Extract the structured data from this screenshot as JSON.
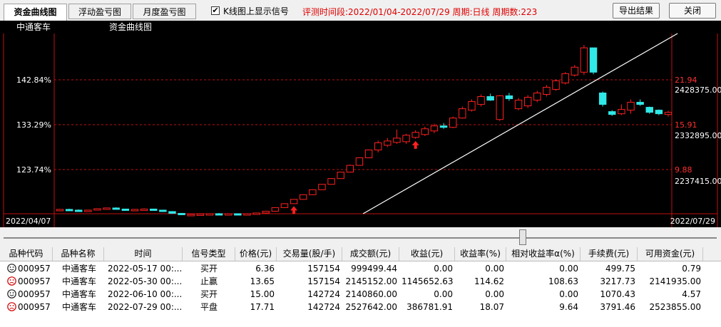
{
  "tabs": [
    {
      "label": "资金曲线图",
      "active": true
    },
    {
      "label": "浮动盈亏图",
      "active": false
    },
    {
      "label": "月度盈亏图",
      "active": false
    }
  ],
  "show_signal": {
    "checked": true,
    "mark": "✔",
    "label": "K线图上显示信号"
  },
  "info_text": "评测时间段:2022/01/04-2022/07/29  周期:日线  周期数:223",
  "buttons": {
    "export": "导出结果",
    "close": "关闭"
  },
  "chart": {
    "stock_name": "中通客车",
    "chart_title": "资金曲线图",
    "left_axis": [
      "142.84%",
      "133.29%",
      "123.74%"
    ],
    "right_axis_prices": [
      "21.94",
      "15.91",
      "9.88"
    ],
    "right_axis_volumes": [
      "2428375.00",
      "2332895.00",
      "2237415.00"
    ],
    "start_date": "2022/04/07",
    "end_date": "2022/07/29",
    "colors": {
      "up": "#ff2020",
      "down": "#30e8e8",
      "line": "#ffffff",
      "grid": "#c01010"
    }
  },
  "chart_data": {
    "type": "candlestick",
    "x_start": "2022/04/07",
    "x_end": "2022/07/29",
    "candles": [
      [
        5.6,
        5.7,
        5.5,
        5.65
      ],
      [
        5.65,
        5.75,
        5.55,
        5.6
      ],
      [
        5.55,
        5.65,
        5.45,
        5.5
      ],
      [
        5.5,
        5.6,
        5.4,
        5.55
      ],
      [
        5.6,
        5.8,
        5.55,
        5.75
      ],
      [
        5.75,
        5.9,
        5.7,
        5.85
      ],
      [
        5.85,
        5.95,
        5.65,
        5.7
      ],
      [
        5.7,
        5.75,
        5.55,
        5.6
      ],
      [
        5.6,
        5.7,
        5.5,
        5.65
      ],
      [
        5.65,
        5.8,
        5.6,
        5.7
      ],
      [
        5.7,
        5.75,
        5.5,
        5.55
      ],
      [
        5.55,
        5.6,
        5.3,
        5.35
      ],
      [
        5.35,
        5.4,
        5.05,
        5.1
      ],
      [
        5.1,
        5.15,
        4.85,
        4.9
      ],
      [
        4.9,
        5.0,
        4.8,
        4.95
      ],
      [
        4.95,
        5.05,
        4.85,
        5.0
      ],
      [
        5.0,
        5.1,
        4.95,
        5.05
      ],
      [
        5.05,
        5.15,
        4.95,
        5.0
      ],
      [
        5.0,
        5.1,
        4.95,
        5.05
      ],
      [
        5.05,
        5.1,
        4.95,
        5.0
      ],
      [
        5.0,
        5.1,
        4.95,
        5.05
      ],
      [
        5.05,
        5.2,
        5.0,
        5.15
      ],
      [
        5.15,
        5.45,
        5.1,
        5.4
      ],
      [
        5.4,
        5.95,
        5.35,
        5.9
      ],
      [
        5.9,
        6.5,
        5.85,
        6.45
      ],
      [
        6.45,
        7.1,
        6.4,
        7.05
      ],
      [
        7.05,
        7.75,
        7.0,
        7.7
      ],
      [
        7.7,
        8.45,
        7.65,
        8.4
      ],
      [
        8.4,
        9.2,
        8.35,
        9.15
      ],
      [
        9.15,
        10.0,
        9.1,
        9.95
      ],
      [
        9.95,
        10.9,
        9.9,
        10.85
      ],
      [
        10.85,
        11.9,
        10.8,
        11.8
      ],
      [
        11.8,
        12.9,
        11.75,
        12.85
      ],
      [
        12.85,
        14.0,
        12.8,
        13.95
      ],
      [
        13.95,
        15.25,
        13.6,
        14.95
      ],
      [
        14.6,
        15.6,
        14.35,
        15.2
      ],
      [
        15.0,
        16.8,
        14.8,
        15.6
      ],
      [
        15.1,
        16.2,
        14.8,
        16.0
      ],
      [
        15.7,
        16.7,
        15.5,
        16.4
      ],
      [
        16.1,
        17.2,
        15.9,
        16.9
      ],
      [
        16.6,
        17.6,
        16.3,
        17.3
      ],
      [
        17.3,
        17.7,
        16.9,
        17.1
      ],
      [
        17.1,
        18.6,
        17.0,
        18.4
      ],
      [
        18.4,
        20.0,
        18.3,
        19.7
      ],
      [
        19.5,
        21.0,
        19.3,
        20.7
      ],
      [
        20.3,
        21.7,
        20.0,
        21.4
      ],
      [
        21.4,
        21.8,
        20.8,
        20.9
      ],
      [
        18.2,
        21.6,
        18.0,
        21.5
      ],
      [
        21.5,
        21.9,
        20.8,
        21.1
      ],
      [
        19.7,
        21.2,
        19.5,
        20.9
      ],
      [
        20.1,
        21.6,
        19.8,
        21.3
      ],
      [
        20.9,
        22.2,
        20.6,
        21.9
      ],
      [
        21.7,
        23.0,
        21.4,
        22.7
      ],
      [
        22.4,
        23.8,
        22.2,
        23.6
      ],
      [
        23.3,
        24.8,
        23.1,
        24.6
      ],
      [
        24.4,
        25.8,
        24.2,
        25.5
      ],
      [
        24.8,
        28.6,
        24.4,
        28.2
      ],
      [
        28.2,
        27.0,
        24.5,
        24.8
      ],
      [
        21.9,
        22.1,
        20.0,
        20.3
      ],
      [
        19.3,
        19.5,
        18.7,
        18.9
      ],
      [
        19.0,
        20.3,
        18.8,
        19.6
      ],
      [
        19.5,
        21.0,
        19.0,
        20.6
      ],
      [
        20.6,
        21.0,
        20.1,
        20.3
      ],
      [
        19.9,
        20.0,
        19.0,
        19.2
      ],
      [
        19.5,
        19.6,
        18.8,
        19.0
      ],
      [
        18.9,
        19.4,
        18.6,
        19.2
      ]
    ],
    "signals": [
      {
        "type": "buy",
        "index": 25
      },
      {
        "type": "buy",
        "index": 38
      }
    ],
    "equity_line": {
      "from_index": 33,
      "to_index": 66
    }
  },
  "table": {
    "columns": [
      "品种代码",
      "品种名称",
      "时间",
      "信号类型",
      "价格(元)",
      "交易量(股/手)",
      "成交额(元)",
      "收益(元)",
      "收益率(%)",
      "相对收益率α(%)",
      "手续费(元)",
      "可用资金(元)"
    ],
    "rows": [
      {
        "result": "neutral",
        "code": "000957",
        "name": "中通客车",
        "time": "2022-05-17 00:...",
        "signal": "买开",
        "price": "6.36",
        "volume": "157154",
        "amount": "999499.44",
        "profit": "0.00",
        "rate": "0.00",
        "alpha": "0.00",
        "fee": "499.75",
        "funds": "0.79"
      },
      {
        "result": "loss",
        "code": "000957",
        "name": "中通客车",
        "time": "2022-05-30 00:...",
        "signal": "止赢",
        "price": "13.65",
        "volume": "157154",
        "amount": "2145152.00",
        "profit": "1145652.63",
        "rate": "114.62",
        "alpha": "108.63",
        "fee": "3217.73",
        "funds": "2141935.00"
      },
      {
        "result": "neutral",
        "code": "000957",
        "name": "中通客车",
        "time": "2022-06-10 00:...",
        "signal": "买开",
        "price": "15.00",
        "volume": "142724",
        "amount": "2140860.00",
        "profit": "0.00",
        "rate": "0.00",
        "alpha": "0.00",
        "fee": "1070.43",
        "funds": "4.57"
      },
      {
        "result": "loss",
        "code": "000957",
        "name": "中通客车",
        "time": "2022-07-29 00:...",
        "signal": "平盘",
        "price": "17.71",
        "volume": "142724",
        "amount": "2527642.00",
        "profit": "386781.91",
        "rate": "18.07",
        "alpha": "9.64",
        "fee": "3791.46",
        "funds": "2523855.00"
      }
    ]
  }
}
